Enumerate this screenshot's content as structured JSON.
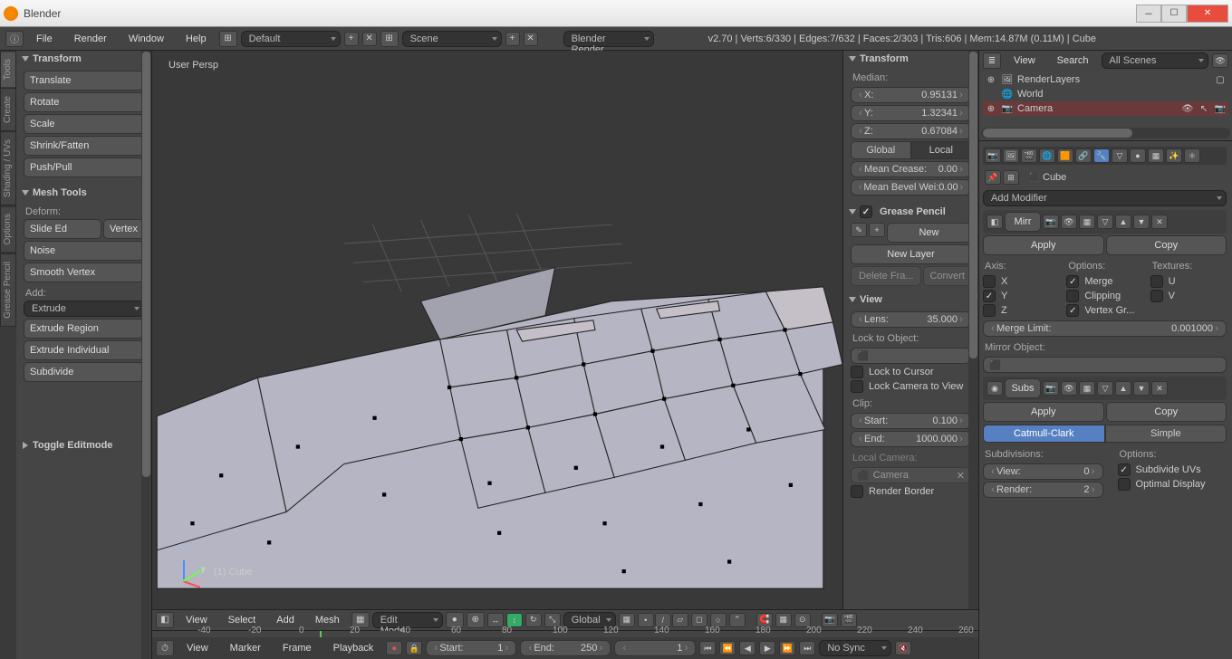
{
  "window": {
    "title": "Blender"
  },
  "topmenu": {
    "file": "File",
    "render": "Render",
    "window": "Window",
    "help": "Help"
  },
  "layout": "Default",
  "scene": "Scene",
  "renderer": "Blender Render",
  "stats": "v2.70 | Verts:6/330 | Edges:7/632 | Faces:2/303 | Tris:606 | Mem:14.87M (0.11M) | Cube",
  "tool_tabs": [
    "Tools",
    "Create",
    "Shading / UVs",
    "Options",
    "Grease Pencil"
  ],
  "transform_panel": {
    "title": "Transform",
    "translate": "Translate",
    "rotate": "Rotate",
    "scale": "Scale",
    "shrink": "Shrink/Fatten",
    "pushpull": "Push/Pull"
  },
  "meshtools": {
    "title": "Mesh Tools",
    "deform": "Deform:",
    "slide": "Slide Ed",
    "vertex": "Vertex",
    "noise": "Noise",
    "smooth": "Smooth Vertex",
    "add": "Add:",
    "extrude": "Extrude",
    "extr_region": "Extrude Region",
    "extr_ind": "Extrude Individual",
    "subdivide": "Subdivide"
  },
  "toggle_edit": "Toggle Editmode",
  "viewport": {
    "persp": "User Persp",
    "object": "(1) Cube"
  },
  "viewbar": {
    "view": "View",
    "select": "Select",
    "add": "Add",
    "mesh": "Mesh",
    "mode": "Edit Mode",
    "orientation": "Global"
  },
  "n_panel": {
    "transform": "Transform",
    "median": "Median:",
    "x": "X:",
    "xv": "0.95131",
    "y": "Y:",
    "yv": "1.32341",
    "z": "Z:",
    "zv": "0.67084",
    "global": "Global",
    "local": "Local",
    "mean_crease": "Mean Crease:",
    "mc_v": "0.00",
    "mean_bevel": "Mean Bevel Wei:",
    "mb_v": "0.00",
    "gp": "Grease Pencil",
    "new": "New",
    "newlayer": "New Layer",
    "delfra": "Delete Fra...",
    "convert": "Convert",
    "view": "View",
    "lens": "Lens:",
    "lens_v": "35.000",
    "lock_obj": "Lock to Object:",
    "lock_cursor": "Lock to Cursor",
    "lock_cam": "Lock Camera to View",
    "clip": "Clip:",
    "start": "Start:",
    "start_v": "0.100",
    "end": "End:",
    "end_v": "1000.000",
    "local_cam": "Local Camera:",
    "camera": "Camera",
    "render_border": "Render Border"
  },
  "outliner": {
    "view": "View",
    "search": "Search",
    "scenes": "All Scenes",
    "items": [
      {
        "i": "🖼",
        "n": "RenderLayers"
      },
      {
        "i": "🌐",
        "n": "World"
      },
      {
        "i": "📷",
        "n": "Camera"
      }
    ]
  },
  "props": {
    "breadcrumb": "Cube",
    "add_modifier": "Add Modifier",
    "mirror": {
      "name": "Mirr",
      "apply": "Apply",
      "copy": "Copy",
      "axis": "Axis:",
      "options": "Options:",
      "textures": "Textures:",
      "x": "X",
      "y": "Y",
      "z": "Z",
      "merge": "Merge",
      "clipping": "Clipping",
      "vertexgr": "Vertex Gr...",
      "u": "U",
      "v": "V",
      "merge_limit": "Merge Limit:",
      "merge_limit_v": "0.001000",
      "mirror_obj": "Mirror Object:"
    },
    "subsurf": {
      "name": "Subs",
      "apply": "Apply",
      "copy": "Copy",
      "catmull": "Catmull-Clark",
      "simple": "Simple",
      "subdivisions": "Subdivisions:",
      "view": "View:",
      "view_v": "0",
      "render": "Render:",
      "render_v": "2",
      "options": "Options:",
      "subdiv_uvs": "Subdivide UVs",
      "optimal": "Optimal Display"
    }
  },
  "timeline": {
    "ticks": [
      -40,
      -20,
      0,
      20,
      40,
      60,
      80,
      100,
      120,
      140,
      160,
      180,
      200,
      220,
      240,
      260
    ],
    "view": "View",
    "marker": "Marker",
    "frame": "Frame",
    "playback": "Playback",
    "start": "Start:",
    "start_v": "1",
    "end": "End:",
    "end_v": "250",
    "current": "1",
    "sync": "No Sync"
  }
}
